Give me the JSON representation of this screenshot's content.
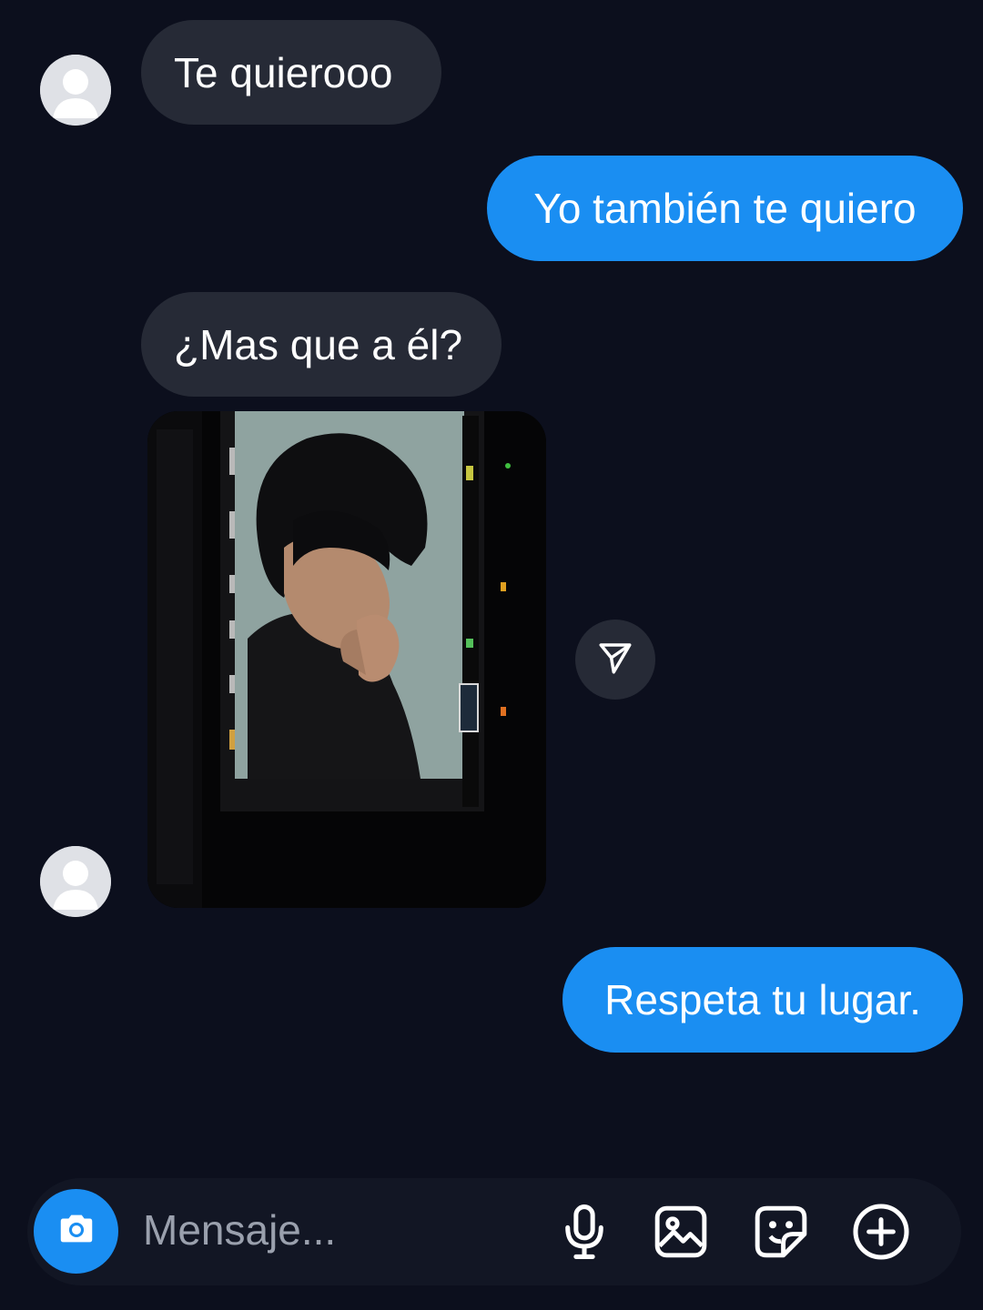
{
  "messages": [
    {
      "sender": "them",
      "text": "Te quierooo"
    },
    {
      "sender": "me",
      "text": "Yo también te quiero"
    },
    {
      "sender": "them",
      "text": "¿Mas que a él?"
    },
    {
      "sender": "them",
      "type": "photo"
    },
    {
      "sender": "me",
      "text": "Respeta tu lugar."
    }
  ],
  "composer": {
    "placeholder": "Mensaje...",
    "icons": [
      "camera-icon",
      "mic-icon",
      "gallery-icon",
      "sticker-icon",
      "plus-icon"
    ]
  },
  "colors": {
    "background": "#0c0f1d",
    "incoming_bubble": "#262a36",
    "outgoing_bubble": "#1a8ef2",
    "accent": "#1a8ef2"
  }
}
